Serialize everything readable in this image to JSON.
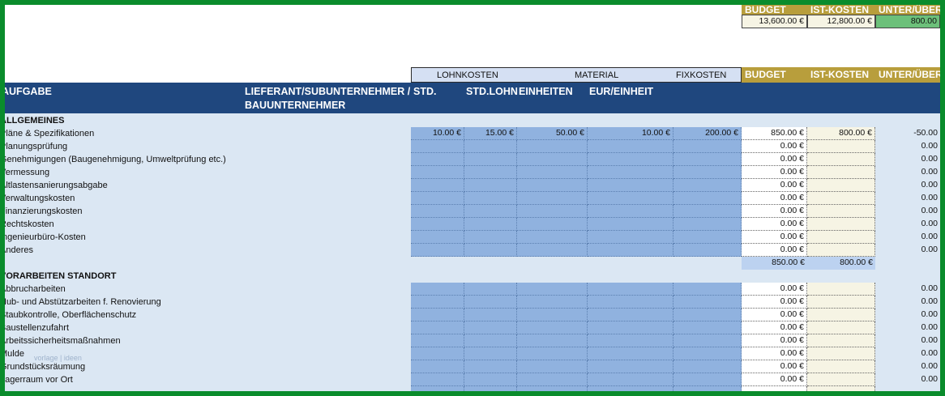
{
  "summary": {
    "headers": [
      "BUDGET",
      "IST-KOSTEN",
      "UNTER/ÜBER"
    ],
    "values": [
      "13,600.00 €",
      "12,800.00 €",
      "800.00"
    ]
  },
  "groups": {
    "labor": "LOHNKOSTEN",
    "material": "MATERIAL",
    "fixed": "FIXKOSTEN",
    "budget": "BUDGET",
    "actual": "IST-KOSTEN",
    "variance": "UNTER/ÜBER"
  },
  "columns": {
    "task": "AUFGABE",
    "supplier_line1": "LIEFERANT/SUBUNTERNEHMER /",
    "supplier_line2": "BAUUNTERNEHMER",
    "hours": "STD.",
    "hourly_wage": "STD.LOHN",
    "units": "EINHEITEN",
    "per_unit": "EUR/EINHEIT"
  },
  "sections": [
    {
      "title": "ALLGEMEINES",
      "rows": [
        {
          "label": "Pläne & Spezifikationen",
          "hours": "10.00 €",
          "wage": "15.00 €",
          "units": "50.00 €",
          "per_unit": "10.00 €",
          "fixed": "200.00 €",
          "budget": "850.00 €",
          "actual": "800.00 €",
          "variance": "-50.00"
        },
        {
          "label": "Planungsprüfung",
          "budget": "0.00 €",
          "variance": "0.00"
        },
        {
          "label": "Genehmigungen (Baugenehmigung, Umweltprüfung etc.)",
          "budget": "0.00 €",
          "variance": "0.00"
        },
        {
          "label": "Vermessung",
          "budget": "0.00 €",
          "variance": "0.00"
        },
        {
          "label": "Altlastensanierungsabgabe",
          "budget": "0.00 €",
          "variance": "0.00"
        },
        {
          "label": "Verwaltungskosten",
          "budget": "0.00 €",
          "variance": "0.00"
        },
        {
          "label": "Finanzierungskosten",
          "budget": "0.00 €",
          "variance": "0.00"
        },
        {
          "label": "Rechtskosten",
          "budget": "0.00 €",
          "variance": "0.00"
        },
        {
          "label": "Ingenieurbüro-Kosten",
          "budget": "0.00 €",
          "variance": "0.00"
        },
        {
          "label": "Anderes",
          "budget": "0.00 €",
          "variance": "0.00"
        }
      ],
      "subtotal_budget": "850.00 €",
      "subtotal_actual": "800.00 €"
    },
    {
      "title": "VORARBEITEN STANDORT",
      "rows": [
        {
          "label": "Abbrucharbeiten",
          "budget": "0.00 €",
          "variance": "0.00"
        },
        {
          "label": "Hub- und Abstützarbeiten f. Renovierung",
          "budget": "0.00 €",
          "variance": "0.00"
        },
        {
          "label": "Staubkontrolle, Oberflächenschutz",
          "budget": "0.00 €",
          "variance": "0.00"
        },
        {
          "label": "Baustellenzufahrt",
          "budget": "0.00 €",
          "variance": "0.00"
        },
        {
          "label": "Arbeitssicherheitsmaßnahmen",
          "budget": "0.00 €",
          "variance": "0.00"
        },
        {
          "label": "Mulde",
          "budget": "0.00 €",
          "variance": "0.00"
        },
        {
          "label": "Grundstücksräumung",
          "budget": "0.00 €",
          "variance": "0.00"
        },
        {
          "label": "Lagerraum vor Ort",
          "budget": "0.00 €",
          "variance": "0.00"
        },
        {
          "label": "",
          "budget": "",
          "variance": ""
        }
      ]
    }
  ],
  "watermark": "vorlage | ideen"
}
